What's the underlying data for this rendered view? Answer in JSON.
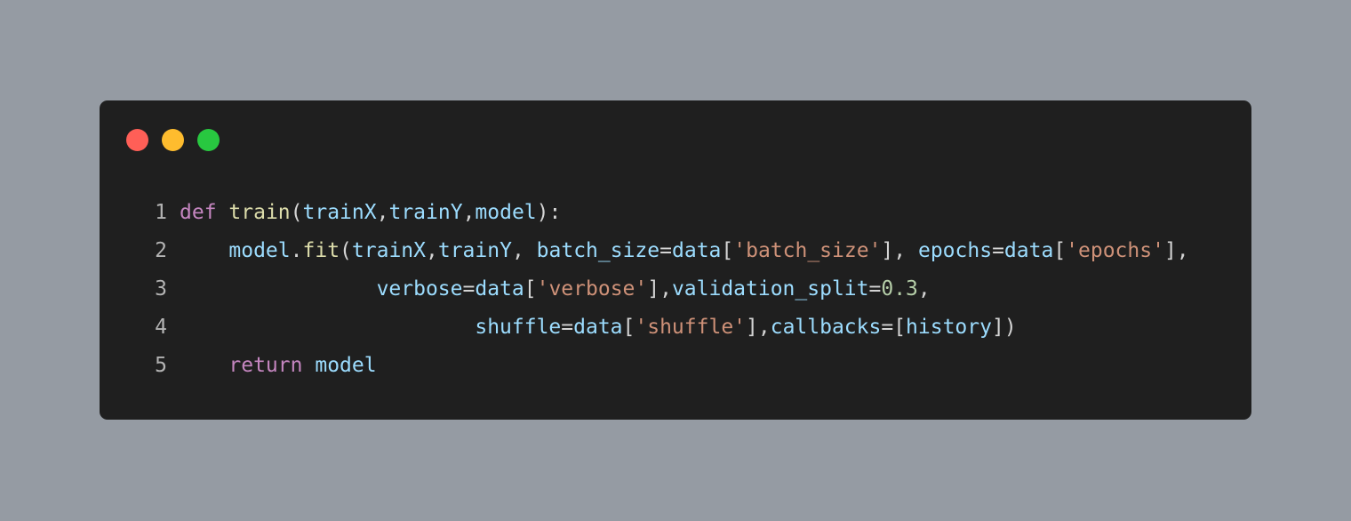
{
  "theme": {
    "page_background": "#959ba3",
    "window_background": "#1f1f1f",
    "line_number_color": "#b3b3b3",
    "token_colors": {
      "kw": "#c586c0",
      "fn": "#dcdcaa",
      "var": "#9cdcfe",
      "punc": "#d4d4d4",
      "str": "#ce9178",
      "num": "#b5cea8"
    }
  },
  "window_controls": [
    {
      "name": "close-dot",
      "color": "#ff5f57"
    },
    {
      "name": "minimize-dot",
      "color": "#febc2e"
    },
    {
      "name": "maximize-dot",
      "color": "#28c840"
    }
  ],
  "code": {
    "language": "python",
    "lines": [
      {
        "number": "1",
        "tokens": [
          {
            "t": "kw",
            "v": "def"
          },
          {
            "t": "punc",
            "v": " "
          },
          {
            "t": "fn",
            "v": "train"
          },
          {
            "t": "punc",
            "v": "("
          },
          {
            "t": "var",
            "v": "trainX"
          },
          {
            "t": "punc",
            "v": ","
          },
          {
            "t": "var",
            "v": "trainY"
          },
          {
            "t": "punc",
            "v": ","
          },
          {
            "t": "var",
            "v": "model"
          },
          {
            "t": "punc",
            "v": "):"
          }
        ]
      },
      {
        "number": "2",
        "tokens": [
          {
            "t": "punc",
            "v": "    "
          },
          {
            "t": "var",
            "v": "model"
          },
          {
            "t": "punc",
            "v": "."
          },
          {
            "t": "fn",
            "v": "fit"
          },
          {
            "t": "punc",
            "v": "("
          },
          {
            "t": "var",
            "v": "trainX"
          },
          {
            "t": "punc",
            "v": ","
          },
          {
            "t": "var",
            "v": "trainY"
          },
          {
            "t": "punc",
            "v": ", "
          },
          {
            "t": "var",
            "v": "batch_size"
          },
          {
            "t": "punc",
            "v": "="
          },
          {
            "t": "var",
            "v": "data"
          },
          {
            "t": "punc",
            "v": "["
          },
          {
            "t": "str",
            "v": "'batch_size'"
          },
          {
            "t": "punc",
            "v": "], "
          },
          {
            "t": "var",
            "v": "epochs"
          },
          {
            "t": "punc",
            "v": "="
          },
          {
            "t": "var",
            "v": "data"
          },
          {
            "t": "punc",
            "v": "["
          },
          {
            "t": "str",
            "v": "'epochs'"
          },
          {
            "t": "punc",
            "v": "],"
          }
        ]
      },
      {
        "number": "3",
        "tokens": [
          {
            "t": "punc",
            "v": "                "
          },
          {
            "t": "var",
            "v": "verbose"
          },
          {
            "t": "punc",
            "v": "="
          },
          {
            "t": "var",
            "v": "data"
          },
          {
            "t": "punc",
            "v": "["
          },
          {
            "t": "str",
            "v": "'verbose'"
          },
          {
            "t": "punc",
            "v": "],"
          },
          {
            "t": "var",
            "v": "validation_split"
          },
          {
            "t": "punc",
            "v": "="
          },
          {
            "t": "num",
            "v": "0.3"
          },
          {
            "t": "punc",
            "v": ","
          }
        ]
      },
      {
        "number": "4",
        "tokens": [
          {
            "t": "punc",
            "v": "                        "
          },
          {
            "t": "var",
            "v": "shuffle"
          },
          {
            "t": "punc",
            "v": "="
          },
          {
            "t": "var",
            "v": "data"
          },
          {
            "t": "punc",
            "v": "["
          },
          {
            "t": "str",
            "v": "'shuffle'"
          },
          {
            "t": "punc",
            "v": "],"
          },
          {
            "t": "var",
            "v": "callbacks"
          },
          {
            "t": "punc",
            "v": "=["
          },
          {
            "t": "var",
            "v": "history"
          },
          {
            "t": "punc",
            "v": "])"
          }
        ]
      },
      {
        "number": "5",
        "tokens": [
          {
            "t": "punc",
            "v": "    "
          },
          {
            "t": "kw",
            "v": "return"
          },
          {
            "t": "punc",
            "v": " "
          },
          {
            "t": "var",
            "v": "model"
          }
        ]
      }
    ]
  }
}
